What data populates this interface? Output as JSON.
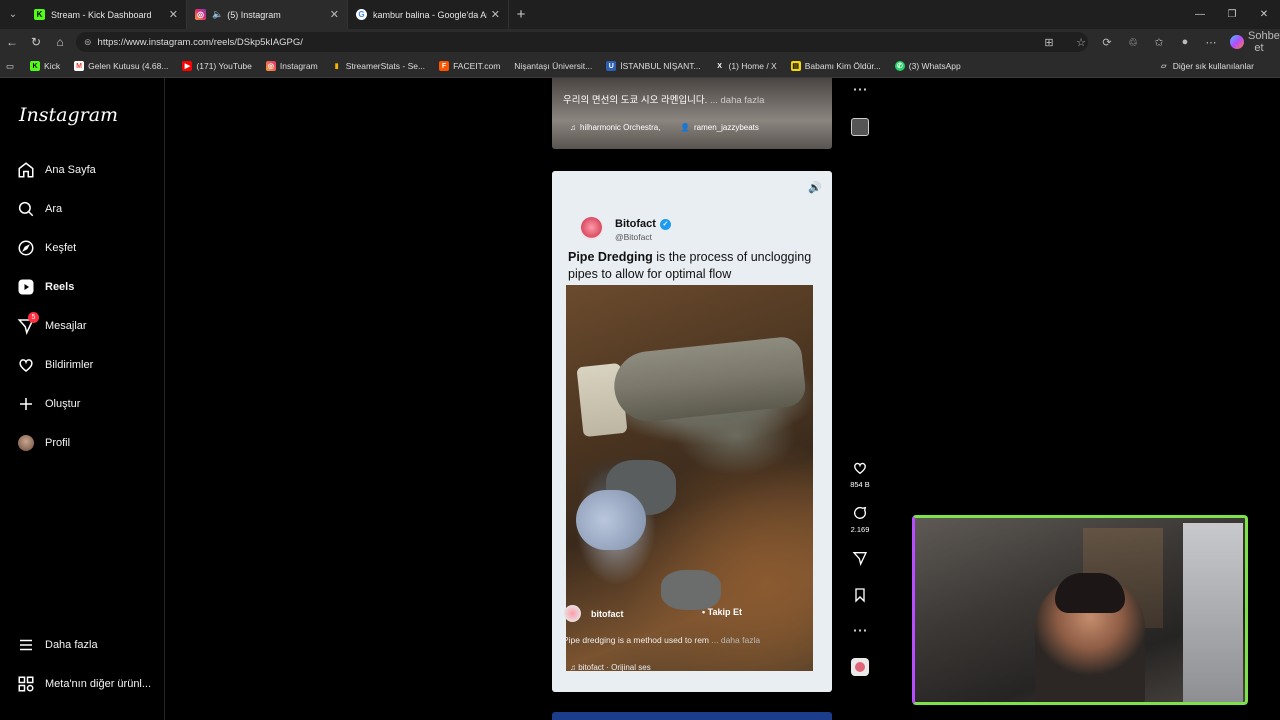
{
  "browser": {
    "tabs": [
      {
        "title": "Stream - Kick Dashboard",
        "active": false
      },
      {
        "title": "(5) Instagram",
        "active": true
      },
      {
        "title": "kambur balina - Google'da Ara",
        "active": false
      }
    ],
    "url": "https://www.instagram.com/reels/DSkp5kIAGPG/",
    "copilot_label": "Sohbet et",
    "bookmarks": [
      "Kick",
      "Gelen Kutusu (4.68...",
      "(171) YouTube",
      "Instagram",
      "StreamerStats - Se...",
      "FACEIT.com",
      "Nişantaşı Üniversit...",
      "İSTANBUL NİŞANT...",
      "(1) Home / X",
      "Babamı Kim Öldür...",
      "(3) WhatsApp"
    ],
    "other_bookmarks": "Diğer sık kullanılanlar"
  },
  "instagram": {
    "logo": "Instagram",
    "nav": [
      {
        "label": "Ana Sayfa",
        "icon": "home-icon"
      },
      {
        "label": "Ara",
        "icon": "search-icon"
      },
      {
        "label": "Keşfet",
        "icon": "explore-icon"
      },
      {
        "label": "Reels",
        "icon": "reels-icon"
      },
      {
        "label": "Mesajlar",
        "icon": "messages-icon",
        "badge": "5"
      },
      {
        "label": "Bildirimler",
        "icon": "heart-icon"
      },
      {
        "label": "Oluştur",
        "icon": "plus-icon"
      },
      {
        "label": "Profil",
        "icon": "avatar"
      }
    ],
    "more": "Daha fazla",
    "meta": "Meta'nın diğer ürünl...",
    "prev_reel": {
      "caption": "우리의 면선의 도쿄 시오 라멘입니다.",
      "more": "... daha fazla",
      "audio": "hilharmonic Orchestra,",
      "collab": "ramen_jazzybeats"
    },
    "reel": {
      "tweet_name": "Bitofact",
      "tweet_handle": "@Bitofact",
      "tweet_bold": "Pipe Dredging",
      "tweet_rest": " is the process of unclogging pipes to allow for optimal flow",
      "username": "bitofact",
      "follow": "Takip Et",
      "caption": "Pipe dredging is a method used to rem",
      "caption_more": "... daha fazla",
      "audio": "bitofact · Orijinal ses"
    },
    "actions": {
      "likes": "854 B",
      "comments": "2.169"
    }
  }
}
